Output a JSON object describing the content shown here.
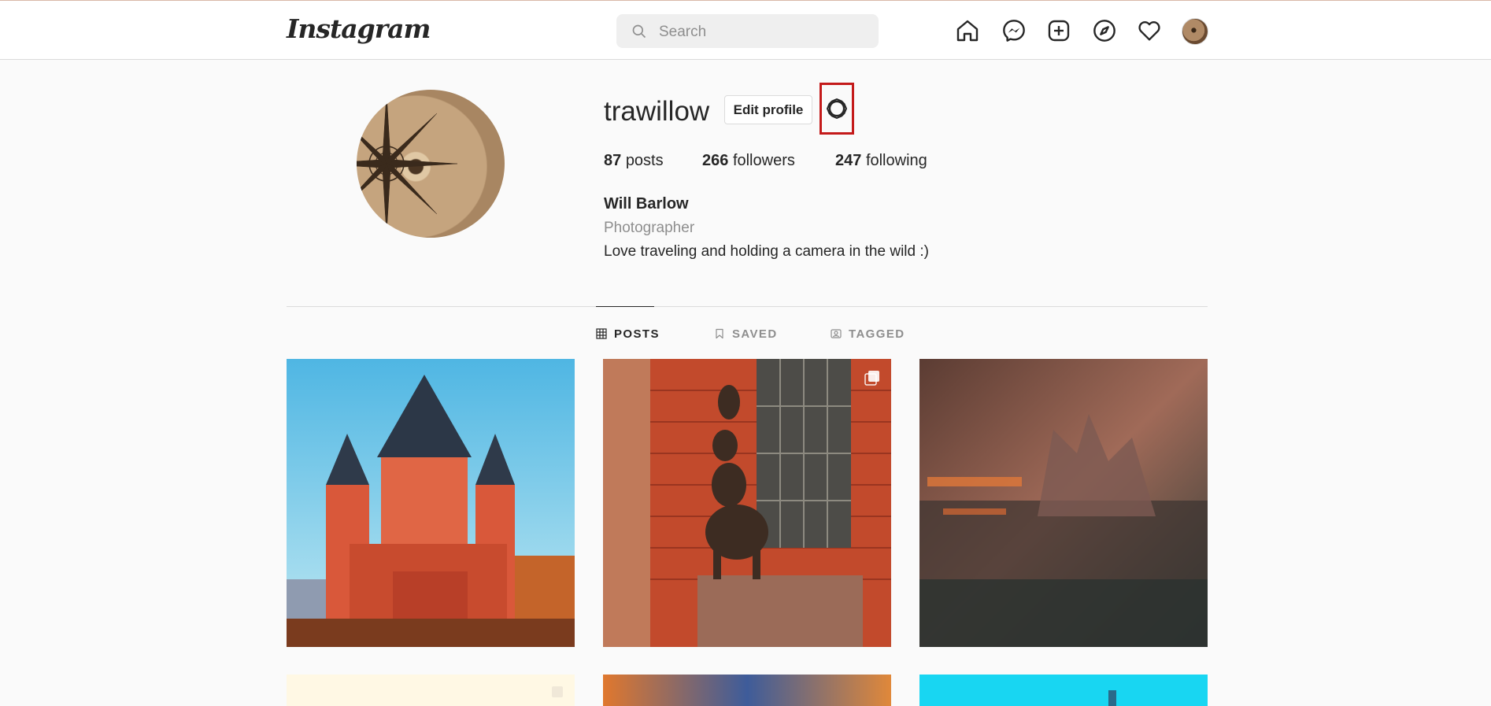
{
  "header": {
    "logo": "Instagram",
    "search": {
      "placeholder": "Search",
      "value": ""
    },
    "icons": [
      "home-icon",
      "messenger-icon",
      "new-post-icon",
      "explore-icon",
      "activity-heart-icon",
      "profile-avatar-icon"
    ]
  },
  "profile": {
    "username": "trawillow",
    "edit_label": "Edit profile",
    "stats": [
      {
        "count": "87",
        "label": "posts"
      },
      {
        "count": "266",
        "label": "followers"
      },
      {
        "count": "247",
        "label": "following"
      }
    ],
    "full_name": "Will Barlow",
    "category": "Photographer",
    "bio": "Love traveling and holding a camera in the wild :)"
  },
  "tabs": [
    {
      "label": "POSTS",
      "icon": "grid-icon",
      "active": true
    },
    {
      "label": "SAVED",
      "icon": "bookmark-icon",
      "active": false
    },
    {
      "label": "TAGGED",
      "icon": "tagged-icon",
      "active": false
    }
  ],
  "colors": {
    "highlight_box": "#c41a1a",
    "text_primary": "#262626",
    "text_secondary": "#8e8e8e",
    "border": "#dbdbdb"
  }
}
